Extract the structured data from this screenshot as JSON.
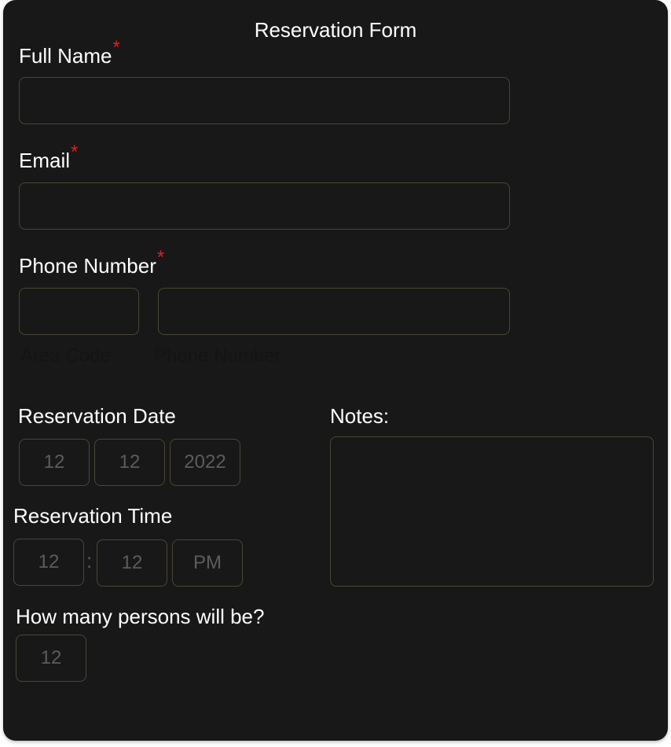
{
  "form": {
    "title": "Reservation Form",
    "full_name": {
      "label": "Full Name",
      "required_mark": "*",
      "value": ""
    },
    "email": {
      "label": "Email",
      "required_mark": "*",
      "value": ""
    },
    "phone": {
      "label": "Phone Number",
      "required_mark": "*",
      "area_code": {
        "value": "",
        "hint": "Area Code"
      },
      "number": {
        "value": "",
        "hint": "Phone Number"
      }
    },
    "reservation_date": {
      "label": "Reservation Date",
      "month": {
        "placeholder": "12"
      },
      "day": {
        "placeholder": "12"
      },
      "year": {
        "placeholder": "2022"
      }
    },
    "reservation_time": {
      "label": "Reservation Time",
      "hour": {
        "placeholder": "12"
      },
      "separator": ":",
      "minute": {
        "placeholder": "12"
      },
      "period": {
        "placeholder": "PM"
      }
    },
    "persons": {
      "label": "How many persons will be?",
      "count": {
        "placeholder": "12"
      }
    },
    "notes": {
      "label": "Notes:",
      "value": ""
    }
  },
  "colors": {
    "card_background": "#181818",
    "field_border": "#4a4636",
    "required_mark": "#e41e1e",
    "label_text": "#ffffff",
    "placeholder_text": "#5c5c5c"
  }
}
